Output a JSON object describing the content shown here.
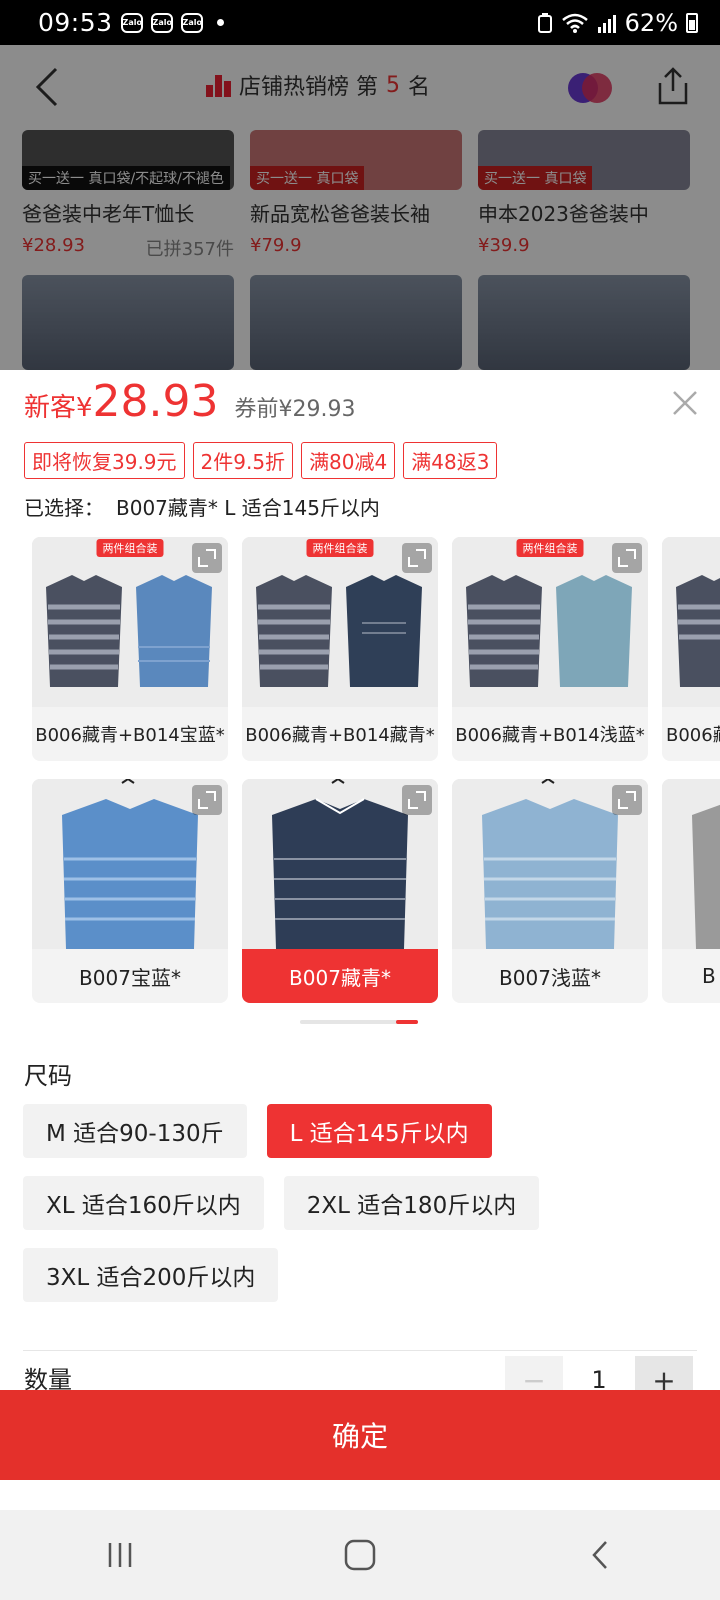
{
  "status_bar": {
    "time": "09:53",
    "apps": [
      "Zalo",
      "Zalo",
      "Zalo"
    ],
    "battery": "62%"
  },
  "background_page": {
    "title_prefix": "店铺热销榜 第",
    "title_rank": "5",
    "title_suffix": "名",
    "products": [
      {
        "promo": "买一送一 真口袋/不起球/不褪色",
        "title": "爸爸装中老年T恤长",
        "price": "¥28.93",
        "sold": "已拼357件"
      },
      {
        "promo": "买一送一 真口袋",
        "title": "新品宽松爸爸装长袖",
        "price": "¥79.9",
        "sold": ""
      },
      {
        "promo": "买一送一 真口袋",
        "title": "申本2023爸爸装中",
        "price": "¥39.9",
        "sold": ""
      }
    ]
  },
  "sheet": {
    "price_tag": "新客¥",
    "price": "28.93",
    "price_before": "券前¥29.93",
    "promo_tags": [
      "即将恢复39.9元",
      "2件9.5折",
      "满80减4",
      "满48返3"
    ],
    "selected_label": "已选择：",
    "selected_value": "B007藏青* L 适合145斤以内",
    "combo_badge": "两件组合装",
    "variants_row1": [
      "B006藏青+B014宝蓝*",
      "B006藏青+B014藏青*",
      "B006藏青+B014浅蓝*",
      "B006藏"
    ],
    "variants_row2": [
      "B007宝蓝*",
      "B007藏青*",
      "B007浅蓝*",
      "B"
    ],
    "selected_variant_index": 1,
    "size_title": "尺码",
    "sizes": [
      "M 适合90-130斤",
      "L 适合145斤以内",
      "XL 适合160斤以内",
      "2XL 适合180斤以内",
      "3XL 适合200斤以内"
    ],
    "selected_size_index": 1,
    "quantity_label": "数量",
    "quantity": "1",
    "confirm_label": "确定"
  },
  "colors": {
    "accent": "#e4302b",
    "sheet_bg": "#ffffff",
    "chip_bg": "#f2f2f2"
  }
}
